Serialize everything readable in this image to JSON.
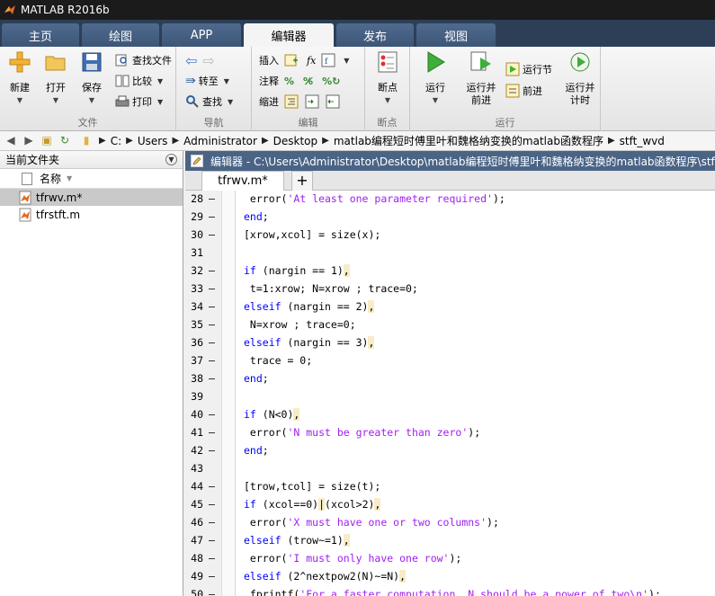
{
  "window": {
    "title": "MATLAB R2016b"
  },
  "ribbon_tabs": [
    "主页",
    "绘图",
    "APP",
    "编辑器",
    "发布",
    "视图"
  ],
  "ribbon": {
    "file_group": {
      "label": "文件",
      "new": "新建",
      "open": "打开",
      "save": "保存",
      "find_files": "查找文件",
      "compare": "比较",
      "print": "打印"
    },
    "nav_group": {
      "label": "导航",
      "goto": "转至",
      "find": "查找"
    },
    "edit_group": {
      "label": "编辑",
      "insert": "插入",
      "comment": "注释",
      "indent": "缩进",
      "fx": "fx"
    },
    "breakpoints_group": {
      "label": "断点",
      "breakpoints": "断点"
    },
    "run_group": {
      "label": "运行",
      "run": "运行",
      "run_advance_1": "运行并",
      "run_advance_2": "前进",
      "run_section": "运行节",
      "advance": "前进",
      "run_time_1": "运行并",
      "run_time_2": "计时"
    }
  },
  "address": {
    "crumbs": [
      "C:",
      "Users",
      "Administrator",
      "Desktop",
      "matlab编程短时傅里叶和魏格纳变换的matlab函数程序",
      "stft_wvd"
    ]
  },
  "current_folder": {
    "title": "当前文件夹",
    "column": "名称",
    "files": [
      {
        "name": "tfrwv.m*",
        "selected": true
      },
      {
        "name": "tfrstft.m",
        "selected": false
      }
    ]
  },
  "editor": {
    "title": "编辑器 - C:\\Users\\Administrator\\Desktop\\matlab编程短时傅里叶和魏格纳变换的matlab函数程序\\stft_wvd\\tfrwv.m*",
    "tab": "tfrwv.m*",
    "new_tab": "+",
    "lines": [
      {
        "n": "28",
        "dash": "–",
        "segs": [
          {
            "t": " error(",
            "c": ""
          },
          {
            "t": "'At least one parameter required'",
            "c": "str"
          },
          {
            "t": ");",
            "c": ""
          }
        ]
      },
      {
        "n": "29",
        "dash": "–",
        "segs": [
          {
            "t": "end",
            "c": "kw"
          },
          {
            "t": ";",
            "c": ""
          }
        ]
      },
      {
        "n": "30",
        "dash": "–",
        "segs": [
          {
            "t": "[xrow,xcol] = size(x);",
            "c": ""
          }
        ]
      },
      {
        "n": "31",
        "dash": "",
        "segs": []
      },
      {
        "n": "32",
        "dash": "–",
        "segs": [
          {
            "t": "if",
            "c": "kw"
          },
          {
            "t": " (nargin == 1)",
            "c": ""
          },
          {
            "t": ",",
            "c": "warn"
          }
        ]
      },
      {
        "n": "33",
        "dash": "–",
        "segs": [
          {
            "t": " t=1:xrow; N=xrow ; trace=0;",
            "c": ""
          }
        ]
      },
      {
        "n": "34",
        "dash": "–",
        "segs": [
          {
            "t": "elseif",
            "c": "kw"
          },
          {
            "t": " (nargin == 2)",
            "c": ""
          },
          {
            "t": ",",
            "c": "warn"
          }
        ]
      },
      {
        "n": "35",
        "dash": "–",
        "segs": [
          {
            "t": " N=xrow ; trace=0;",
            "c": ""
          }
        ]
      },
      {
        "n": "36",
        "dash": "–",
        "segs": [
          {
            "t": "elseif",
            "c": "kw"
          },
          {
            "t": " (nargin == 3)",
            "c": ""
          },
          {
            "t": ",",
            "c": "warn"
          }
        ]
      },
      {
        "n": "37",
        "dash": "–",
        "segs": [
          {
            "t": " trace = 0;",
            "c": ""
          }
        ]
      },
      {
        "n": "38",
        "dash": "–",
        "segs": [
          {
            "t": "end",
            "c": "kw"
          },
          {
            "t": ";",
            "c": ""
          }
        ]
      },
      {
        "n": "39",
        "dash": "",
        "segs": []
      },
      {
        "n": "40",
        "dash": "–",
        "segs": [
          {
            "t": "if",
            "c": "kw"
          },
          {
            "t": " (N<0)",
            "c": ""
          },
          {
            "t": ",",
            "c": "warn"
          }
        ]
      },
      {
        "n": "41",
        "dash": "–",
        "segs": [
          {
            "t": " error(",
            "c": ""
          },
          {
            "t": "'N must be greater than zero'",
            "c": "str"
          },
          {
            "t": ");",
            "c": ""
          }
        ]
      },
      {
        "n": "42",
        "dash": "–",
        "segs": [
          {
            "t": "end",
            "c": "kw"
          },
          {
            "t": ";",
            "c": ""
          }
        ]
      },
      {
        "n": "43",
        "dash": "",
        "segs": []
      },
      {
        "n": "44",
        "dash": "–",
        "segs": [
          {
            "t": "[trow,tcol] = size(t);",
            "c": ""
          }
        ]
      },
      {
        "n": "45",
        "dash": "–",
        "segs": [
          {
            "t": "if",
            "c": "kw"
          },
          {
            "t": " (xcol==0)",
            "c": ""
          },
          {
            "t": "|",
            "c": "warn"
          },
          {
            "t": "(xcol>2)",
            "c": ""
          },
          {
            "t": ",",
            "c": "warn"
          }
        ]
      },
      {
        "n": "46",
        "dash": "–",
        "segs": [
          {
            "t": " error(",
            "c": ""
          },
          {
            "t": "'X must have one or two columns'",
            "c": "str"
          },
          {
            "t": ");",
            "c": ""
          }
        ]
      },
      {
        "n": "47",
        "dash": "–",
        "segs": [
          {
            "t": "elseif",
            "c": "kw"
          },
          {
            "t": " (trow~=1)",
            "c": ""
          },
          {
            "t": ",",
            "c": "warn"
          }
        ]
      },
      {
        "n": "48",
        "dash": "–",
        "segs": [
          {
            "t": " error(",
            "c": ""
          },
          {
            "t": "'I must only have one row'",
            "c": "str"
          },
          {
            "t": ");",
            "c": ""
          }
        ]
      },
      {
        "n": "49",
        "dash": "–",
        "segs": [
          {
            "t": "elseif",
            "c": "kw"
          },
          {
            "t": " (2^nextpow2(N)~=N)",
            "c": ""
          },
          {
            "t": ",",
            "c": "warn"
          }
        ]
      },
      {
        "n": "50",
        "dash": "–",
        "segs": [
          {
            "t": " fprintf(",
            "c": ""
          },
          {
            "t": "'For a faster computation, N should be a power of two\\n'",
            "c": "str"
          },
          {
            "t": ");",
            "c": ""
          }
        ]
      }
    ]
  }
}
